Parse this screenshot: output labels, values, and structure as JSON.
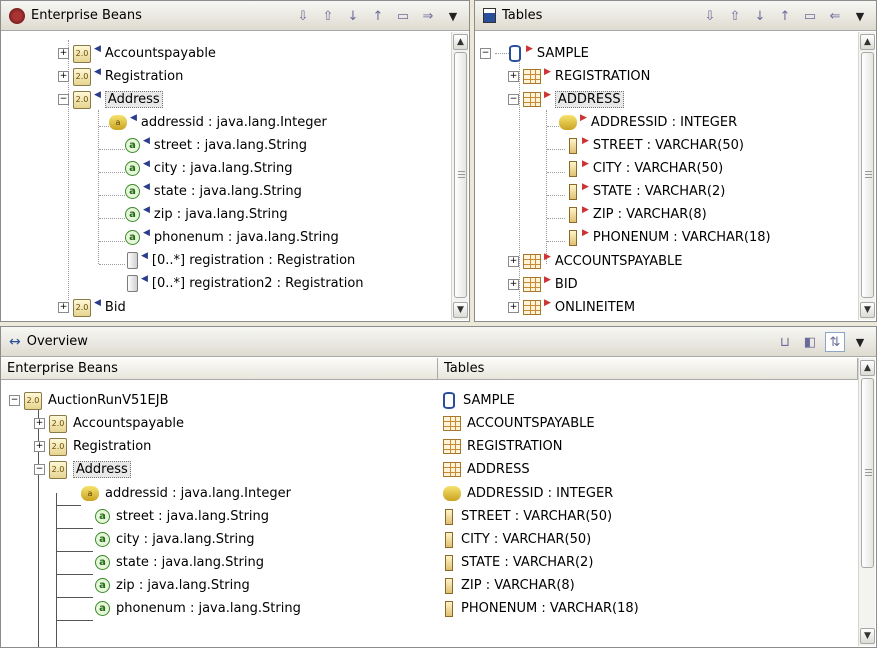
{
  "left_pane": {
    "title": "Enterprise Beans",
    "tree": [
      {
        "id": "accountspayable",
        "label": "Accountspayable",
        "toggle": "+"
      },
      {
        "id": "registration",
        "label": "Registration",
        "toggle": "+"
      },
      {
        "id": "address",
        "label": "Address",
        "toggle": "−"
      },
      {
        "id": "addressid",
        "label": "addressid : java.lang.Integer"
      },
      {
        "id": "street",
        "label": "street : java.lang.String"
      },
      {
        "id": "city",
        "label": "city : java.lang.String"
      },
      {
        "id": "state",
        "label": "state : java.lang.String"
      },
      {
        "id": "zip",
        "label": "zip : java.lang.String"
      },
      {
        "id": "phonenum",
        "label": "phonenum : java.lang.String"
      },
      {
        "id": "registration-rel",
        "label": "[0..*] registration : Registration"
      },
      {
        "id": "registration2-rel",
        "label": "[0..*] registration2 : Registration"
      },
      {
        "id": "bid",
        "label": "Bid",
        "toggle": "+"
      }
    ]
  },
  "right_pane": {
    "title": "Tables",
    "tree": [
      {
        "id": "sample",
        "label": "SAMPLE",
        "toggle": "−"
      },
      {
        "id": "registration",
        "label": "REGISTRATION",
        "toggle": "+"
      },
      {
        "id": "address",
        "label": "ADDRESS",
        "toggle": "−"
      },
      {
        "id": "addressid",
        "label": "ADDRESSID : INTEGER"
      },
      {
        "id": "street",
        "label": "STREET : VARCHAR(50)"
      },
      {
        "id": "city",
        "label": "CITY : VARCHAR(50)"
      },
      {
        "id": "state",
        "label": "STATE : VARCHAR(2)"
      },
      {
        "id": "zip",
        "label": "ZIP : VARCHAR(8)"
      },
      {
        "id": "phonenum",
        "label": "PHONENUM : VARCHAR(18)"
      },
      {
        "id": "accountspayable",
        "label": "ACCOUNTSPAYABLE",
        "toggle": "+"
      },
      {
        "id": "bid",
        "label": "BID",
        "toggle": "+"
      },
      {
        "id": "onlineitem",
        "label": "ONLINEITEM",
        "toggle": "+"
      }
    ]
  },
  "overview": {
    "title": "Overview",
    "columns": [
      "Enterprise Beans",
      "Tables"
    ],
    "rows": [
      {
        "bean": "AuctionRunV51EJB",
        "table": "SAMPLE",
        "toggle": "−"
      },
      {
        "bean": "Accountspayable",
        "table": "ACCOUNTSPAYABLE",
        "toggle": "+"
      },
      {
        "bean": "Registration",
        "table": "REGISTRATION",
        "toggle": "+"
      },
      {
        "bean": "Address",
        "table": "ADDRESS",
        "toggle": "−"
      },
      {
        "bean": "addressid : java.lang.Integer",
        "table": "ADDRESSID : INTEGER"
      },
      {
        "bean": "street : java.lang.String",
        "table": "STREET : VARCHAR(50)"
      },
      {
        "bean": "city : java.lang.String",
        "table": "CITY : VARCHAR(50)"
      },
      {
        "bean": "state : java.lang.String",
        "table": "STATE : VARCHAR(2)"
      },
      {
        "bean": "zip : java.lang.String",
        "table": "ZIP : VARCHAR(8)"
      },
      {
        "bean": "phonenum : java.lang.String",
        "table": "PHONENUM : VARCHAR(18)"
      }
    ]
  },
  "icon_labels": {
    "ejb_version": "2.0",
    "attribute": "a",
    "key_attribute": "a",
    "collapse": "−",
    "expand": "+"
  },
  "icons": {
    "left_toolbar": [
      "collapse-all-icon",
      "expand-icon",
      "down-arrow-icon",
      "up-arrow-icon",
      "save-icon",
      "map-forward-icon",
      "view-menu-icon"
    ],
    "right_toolbar": [
      "collapse-all-icon",
      "expand-icon",
      "down-arrow-icon",
      "up-arrow-icon",
      "save-icon",
      "map-back-icon",
      "view-menu-icon"
    ],
    "overview_toolbar": [
      "filter-icon",
      "columns-icon",
      "layout-icon",
      "view-menu-icon"
    ]
  },
  "colors": {
    "selection_bg": "#e8e8e8",
    "bean_marker": "#2a3c8c",
    "table_marker": "#cc3333"
  }
}
